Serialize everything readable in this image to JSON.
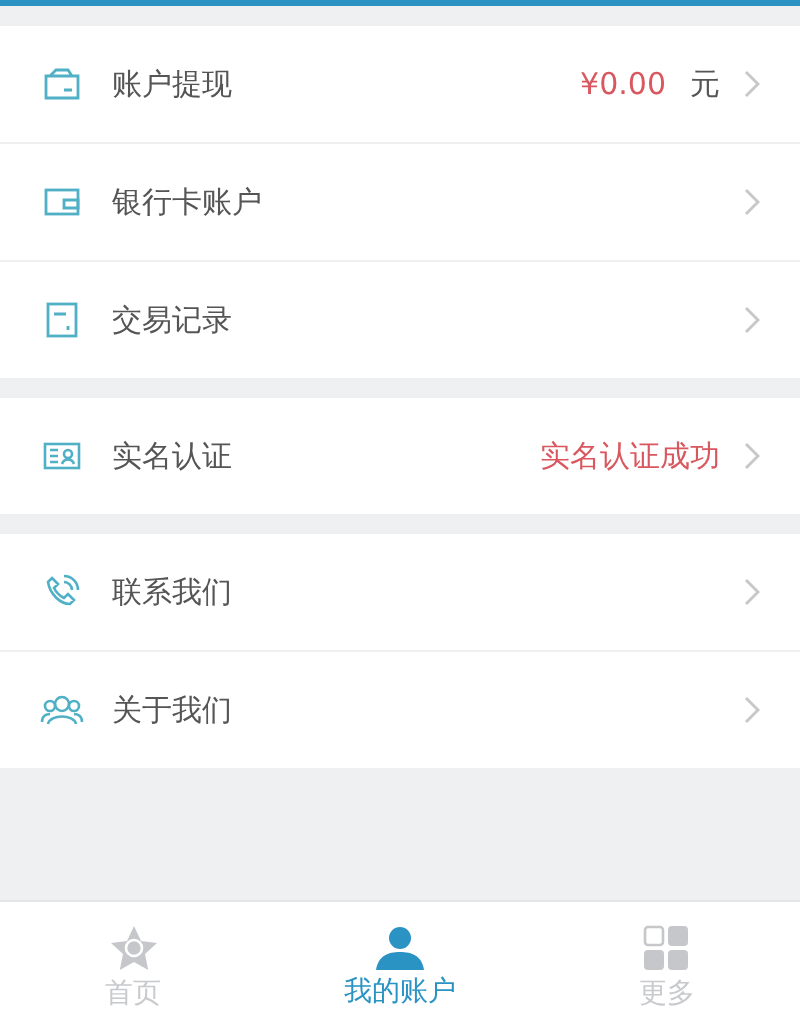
{
  "groups": [
    {
      "items": [
        {
          "kind": "wallet",
          "label": "账户提现",
          "value": "¥0.00",
          "unit": "元"
        },
        {
          "kind": "card",
          "label": "银行卡账户"
        },
        {
          "kind": "record",
          "label": "交易记录"
        }
      ]
    },
    {
      "items": [
        {
          "kind": "idcard",
          "label": "实名认证",
          "value": "实名认证成功"
        }
      ]
    },
    {
      "items": [
        {
          "kind": "phone",
          "label": "联系我们"
        },
        {
          "kind": "people",
          "label": "关于我们"
        }
      ]
    }
  ],
  "tabs": [
    {
      "kind": "star",
      "label": "首页",
      "selected": false
    },
    {
      "kind": "person",
      "label": "我的账户",
      "selected": true
    },
    {
      "kind": "grid",
      "label": "更多",
      "selected": false
    }
  ]
}
